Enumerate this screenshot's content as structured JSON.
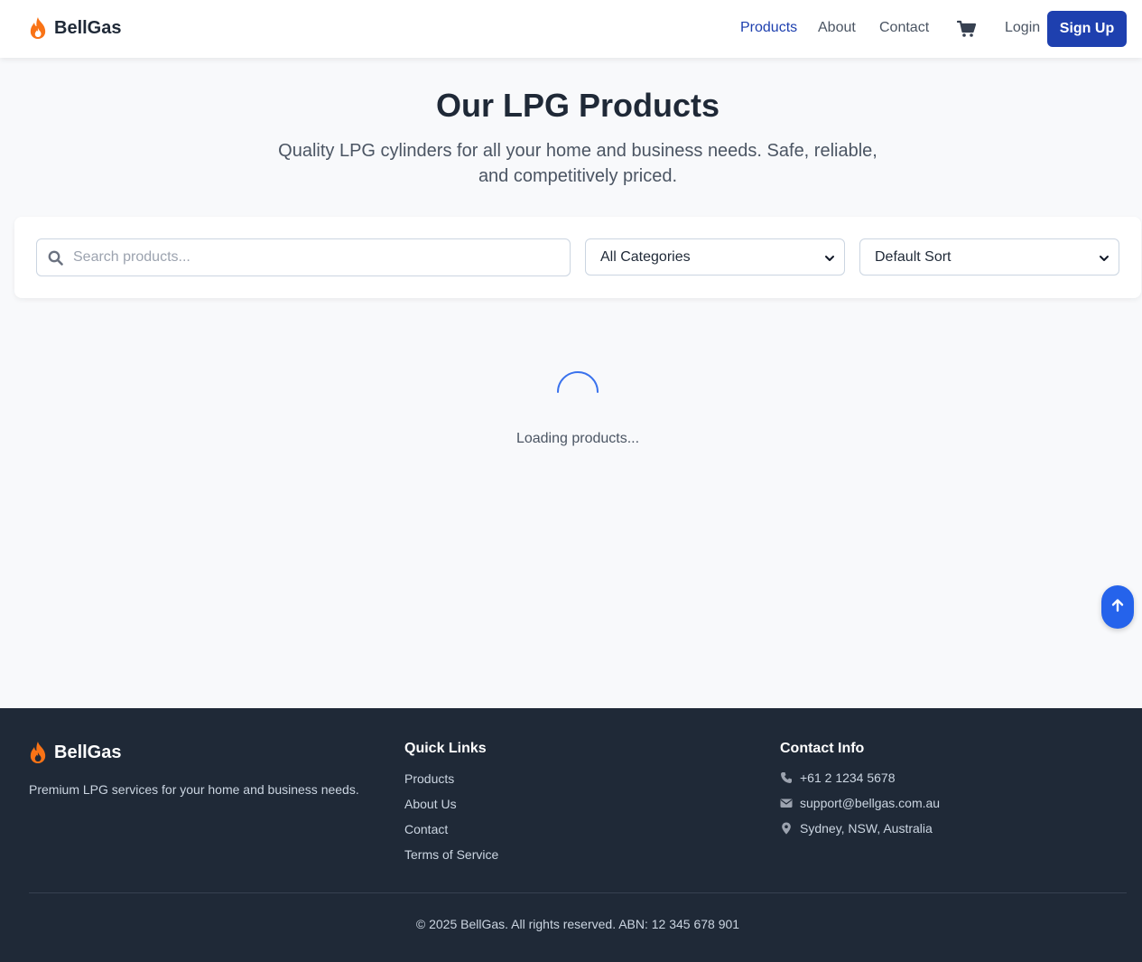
{
  "header": {
    "brand": "BellGas",
    "nav": [
      {
        "label": "Products",
        "active": true
      },
      {
        "label": "About",
        "active": false
      },
      {
        "label": "Contact",
        "active": false
      }
    ],
    "cart_icon": "cart-icon",
    "login_label": "Login",
    "signup_label": "Sign Up"
  },
  "hero": {
    "title": "Our LPG Products",
    "subtitle": "Quality LPG cylinders for all your home and business needs. Safe, reliable, and competitively priced."
  },
  "filters": {
    "search_placeholder": "Search products...",
    "search_value": "",
    "category_selected": "All Categories",
    "sort_selected": "Default Sort"
  },
  "loading": {
    "text": "Loading products..."
  },
  "footer": {
    "brand": "BellGas",
    "tagline": "Premium LPG services for your home and business needs.",
    "quick_links_heading": "Quick Links",
    "quick_links": [
      "Products",
      "About Us",
      "Contact",
      "Terms of Service"
    ],
    "contact_heading": "Contact Info",
    "phone": "+61 2 1234 5678",
    "email": "support@bellgas.com.au",
    "location": "Sydney, NSW, Australia",
    "copyright": "© 2025 BellGas. All rights reserved. ABN: 12 345 678 901"
  },
  "colors": {
    "brand_flame": "#f97316",
    "primary": "#1e40af",
    "accent": "#2563eb",
    "footer_bg": "#1f2937"
  }
}
